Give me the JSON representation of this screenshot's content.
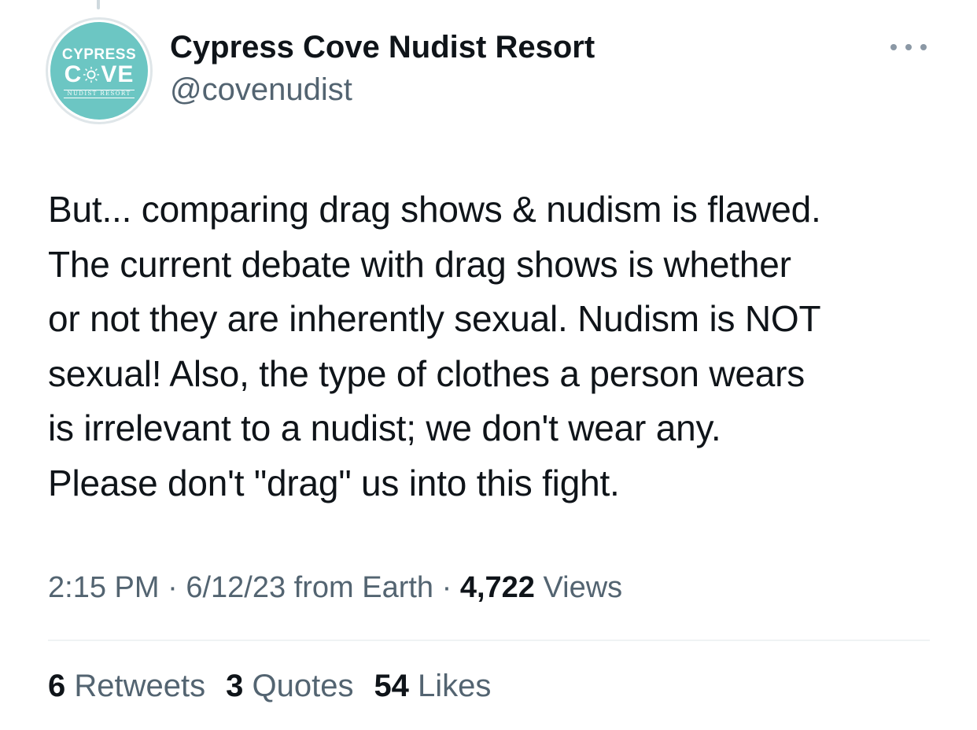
{
  "tweet": {
    "author": {
      "display_name": "Cypress Cove Nudist Resort",
      "handle": "@covenudist",
      "avatar": {
        "logo_top": "CYPRESS",
        "logo_mid_left": "C",
        "logo_mid_right": "VE",
        "logo_bottom": "NUDIST RESORT",
        "bg_color": "#6cc6c3"
      }
    },
    "more_icon": "more-horizontal-icon",
    "text": "But... comparing drag shows & nudism is flawed.\nThe current debate with drag shows is whether\nor not they are inherently sexual. Nudism is NOT\nsexual! Also, the type of clothes a person wears\nis irrelevant to a nudist; we don't wear any.\nPlease don't \"drag\" us into this fight.",
    "meta": {
      "time": "2:15 PM",
      "sep1": " · ",
      "date": "6/12/23",
      "source": " from Earth",
      "sep2": " · ",
      "views_count": "4,722",
      "views_label": " Views"
    },
    "stats": {
      "retweets_count": "6",
      "retweets_label": " Retweets",
      "quotes_count": "3",
      "quotes_label": " Quotes",
      "likes_count": "54",
      "likes_label": " Likes"
    }
  },
  "colors": {
    "primary_text": "#0f1419",
    "secondary_text": "#536471",
    "divider": "#eff3f4"
  }
}
